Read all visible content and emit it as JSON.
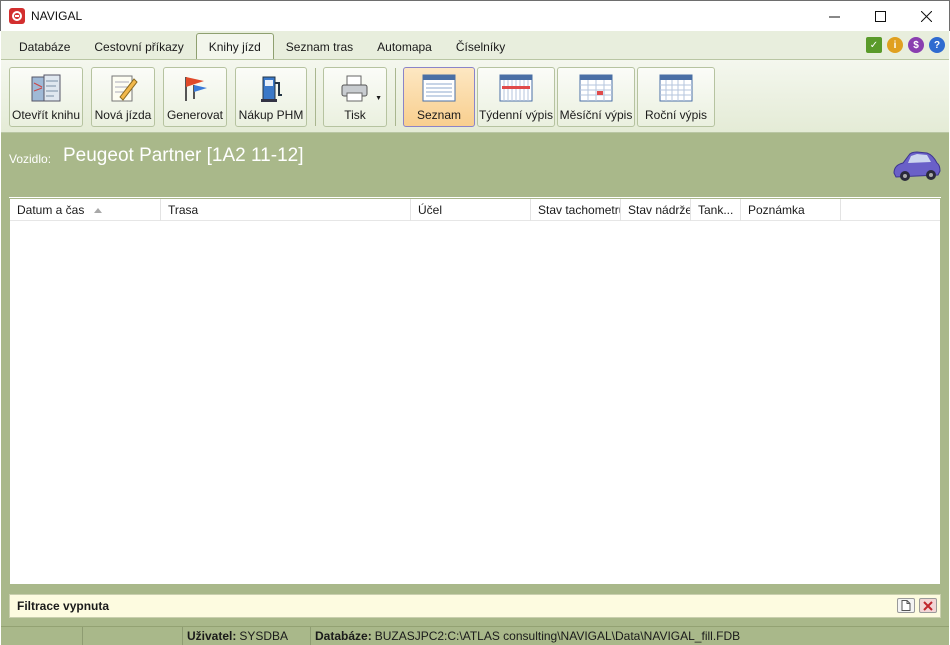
{
  "window": {
    "title": "NAVIGAL"
  },
  "menu": {
    "tabs": [
      {
        "label": "Databáze"
      },
      {
        "label": "Cestovní příkazy"
      },
      {
        "label": "Knihy jízd"
      },
      {
        "label": "Seznam tras"
      },
      {
        "label": "Automapa"
      },
      {
        "label": "Číselníky"
      }
    ],
    "active_tab": "Knihy jízd"
  },
  "ribbon": {
    "open_book": "Otevřít knihu",
    "new_ride": "Nová jízda",
    "generate": "Generovat",
    "fuel_purchase": "Nákup PHM",
    "print": "Tisk",
    "views": [
      {
        "label": "Seznam",
        "selected": true
      },
      {
        "label": "Týdenní výpis",
        "selected": false
      },
      {
        "label": "Měsíční výpis",
        "selected": false
      },
      {
        "label": "Roční výpis",
        "selected": false
      }
    ]
  },
  "vehicle": {
    "label": "Vozidlo:",
    "name": "Peugeot Partner [1A2 11-12]"
  },
  "table": {
    "columns": [
      {
        "label": "Datum a čas",
        "sorted": "asc"
      },
      {
        "label": "Trasa"
      },
      {
        "label": "Účel"
      },
      {
        "label": "Stav tachometru"
      },
      {
        "label": "Stav nádrže"
      },
      {
        "label": "Tank..."
      },
      {
        "label": "Poznámka"
      }
    ],
    "rows": []
  },
  "filter": {
    "status": "Filtrace vypnuta"
  },
  "status": {
    "user_label": "Uživatel:",
    "user": "SYSDBA",
    "db_label": "Databáze:",
    "db": "BUZASJPC2:C:\\ATLAS consulting\\NAVIGAL\\Data\\NAVIGAL_fill.FDB"
  },
  "colors": {
    "accent_green": "#a9b88a",
    "selected_view": "#f8cf8f",
    "app_red": "#d32f2f"
  }
}
